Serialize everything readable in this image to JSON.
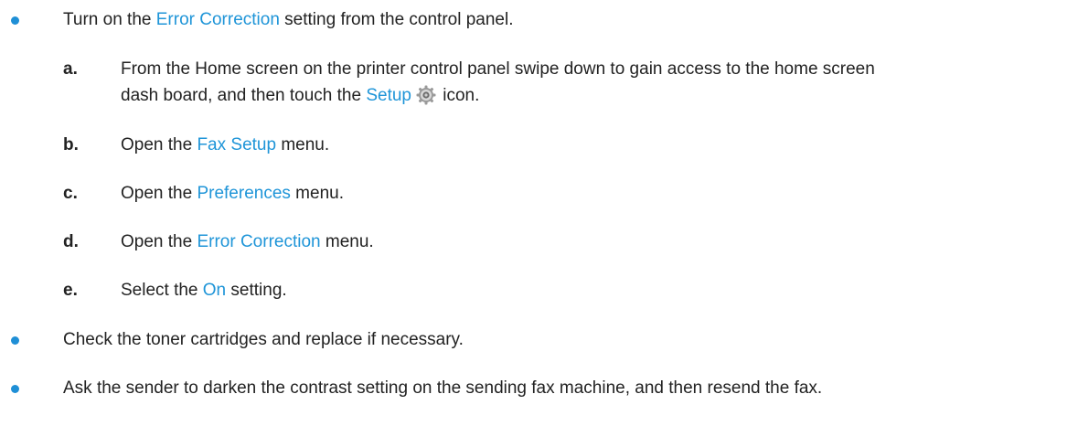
{
  "colors": {
    "link": "#1f95d8",
    "bullet": "#1f8fd6",
    "text": "#222222"
  },
  "bullet1": {
    "pre": "Turn on the ",
    "link": "Error Correction",
    "post": " setting from the control panel."
  },
  "steps": {
    "a": {
      "letter": "a.",
      "line1": "From the Home screen on the printer control panel swipe down to gain access to the home screen",
      "line2_pre": "dash board, and then touch the ",
      "link": "Setup",
      "icon": "gear-icon",
      "line2_post": " icon."
    },
    "b": {
      "letter": "b.",
      "pre": "Open the ",
      "link": "Fax Setup",
      "post": " menu."
    },
    "c": {
      "letter": "c.",
      "pre": "Open the ",
      "link": "Preferences",
      "post": " menu."
    },
    "d": {
      "letter": "d.",
      "pre": "Open the ",
      "link": "Error Correction",
      "post": " menu."
    },
    "e": {
      "letter": "e.",
      "pre": "Select the ",
      "link": "On",
      "post": " setting."
    }
  },
  "bullet2": {
    "text": "Check the toner cartridges and replace if necessary."
  },
  "bullet3": {
    "text": "Ask the sender to darken the contrast setting on the sending fax machine, and then resend the fax."
  }
}
